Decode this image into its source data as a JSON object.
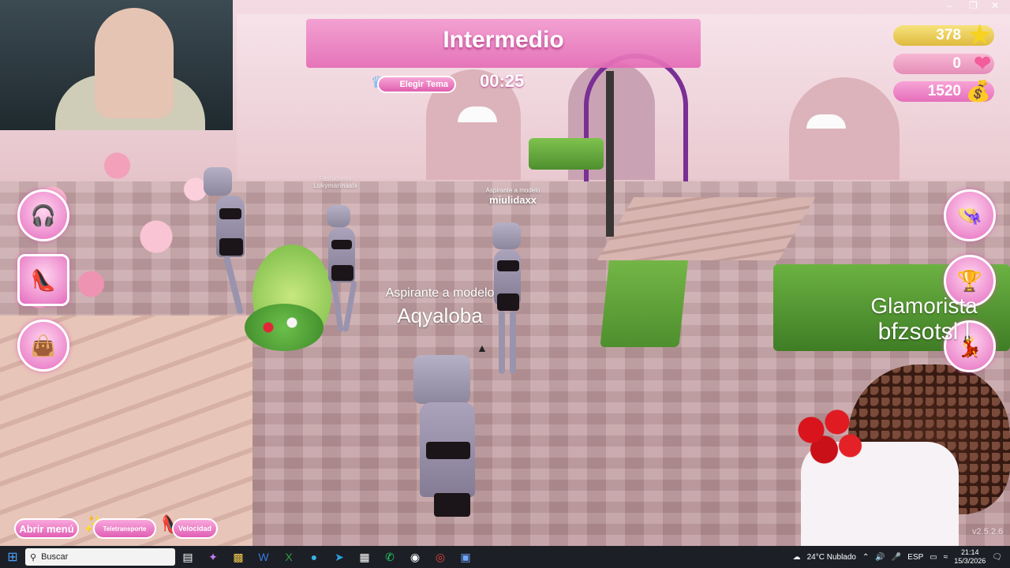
{
  "game": {
    "banner_title": "Intermedio",
    "theme_button": "Elegir Tema",
    "timer": "00:25"
  },
  "currency": {
    "stars": "378",
    "hearts": "0",
    "money": "1520"
  },
  "players": [
    {
      "role": "Aspirante a modelo",
      "name": "Aqyaloba"
    },
    {
      "role": "Aspirante a modelo",
      "name": "miulidaxx"
    },
    {
      "role": "Glamorista",
      "name": "bfzsotsl  l"
    },
    {
      "role": "Fashionista",
      "name": "Lukymarinaalx"
    }
  ],
  "bottom_buttons": {
    "menu": "Abrir menú",
    "teleport": "Teletransporte",
    "speed": "Velocidad"
  },
  "version": "v2.5.2.6",
  "taskbar": {
    "search_placeholder": "Buscar",
    "weather": "24°C  Nublado",
    "language": "ESP",
    "time": "21:14",
    "date": "15/3/2026"
  },
  "icons": {
    "star": "star-icon",
    "heart": "heart-icon",
    "money": "money-bag-icon",
    "wardrobe": "wardrobe-icon",
    "heels": "heels-icon",
    "bag": "handbag-icon",
    "hat": "hat-icon",
    "trophy": "trophy-icon",
    "pose": "pose-icon"
  },
  "colors": {
    "accent_pink": "#e46bb5",
    "gold": "#dfba3e"
  }
}
